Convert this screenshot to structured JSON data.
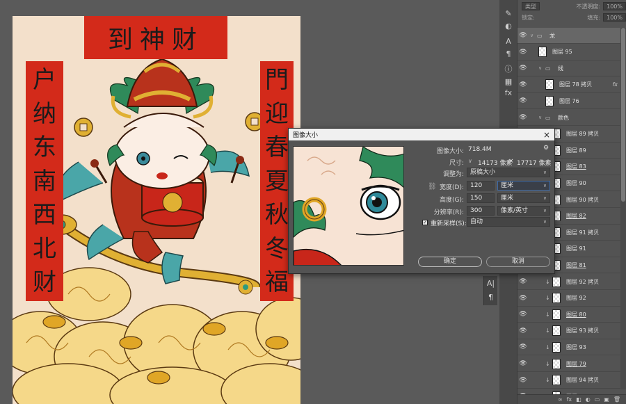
{
  "canvas": {
    "title_banner": "到神财",
    "left_banner": [
      "户",
      "纳",
      "东",
      "南",
      "西",
      "北",
      "财"
    ],
    "right_banner": [
      "門",
      "迎",
      "春",
      "夏",
      "秋",
      "冬",
      "福"
    ]
  },
  "dialog": {
    "title": "图像大小",
    "close_icon": "×",
    "image_size_label": "图像大小:",
    "image_size_value": "718.4M",
    "gear_icon": "⚙",
    "dimensions_label": "尺寸:",
    "dimensions_w": "14173 像素",
    "dimensions_x": "×",
    "dimensions_h": "17717 像素",
    "fit_to_label": "调整为:",
    "fit_to_value": "原稿大小",
    "width_label": "宽度(D):",
    "width_value": "120",
    "width_unit": "厘米",
    "height_label": "高度(G):",
    "height_value": "150",
    "height_unit": "厘米",
    "resolution_label": "分辨率(R):",
    "resolution_value": "300",
    "resolution_unit": "像素/英寸",
    "resample_label": "重新采样(S):",
    "resample_value": "自动",
    "resample_checked": "✓",
    "ok_label": "确定",
    "cancel_label": "取消"
  },
  "tool_strip": [
    "A|",
    "¶"
  ],
  "panel": {
    "top_row1": [
      "类型",
      "不透明度:",
      "100%"
    ],
    "top_row2": [
      "锁定:",
      "填充:",
      "100%"
    ],
    "layers": [
      {
        "name": "龙",
        "type": "folder",
        "selected": true
      },
      {
        "name": "图层 95",
        "type": "layer"
      },
      {
        "name": "线",
        "type": "folder"
      },
      {
        "name": "图层 78 拷贝",
        "type": "layer",
        "fx": "fx"
      },
      {
        "name": "图层 76",
        "type": "layer"
      },
      {
        "name": "颜色",
        "type": "folder"
      },
      {
        "name": "图层 89 拷贝",
        "type": "layer"
      },
      {
        "name": "图层 89",
        "type": "layer"
      },
      {
        "name": "图层 83",
        "type": "layer",
        "underline": true
      },
      {
        "name": "图层 90",
        "type": "layer"
      },
      {
        "name": "图层 90 拷贝",
        "type": "layer"
      },
      {
        "name": "图层 82",
        "type": "layer",
        "underline": true
      },
      {
        "name": "图层 91 拷贝",
        "type": "layer"
      },
      {
        "name": "图层 91",
        "type": "layer"
      },
      {
        "name": "图层 81",
        "type": "layer",
        "underline": true
      },
      {
        "name": "图层 92 拷贝",
        "type": "layer"
      },
      {
        "name": "图层 92",
        "type": "layer"
      },
      {
        "name": "图层 80",
        "type": "layer",
        "underline": true
      },
      {
        "name": "图层 93 拷贝",
        "type": "layer"
      },
      {
        "name": "图层 93",
        "type": "layer"
      },
      {
        "name": "图层 79",
        "type": "layer",
        "underline": true
      },
      {
        "name": "图层 94 拷贝",
        "type": "layer"
      },
      {
        "name": "图层 94",
        "type": "layer"
      }
    ],
    "footer_icons": [
      "∞",
      "fx",
      "◧",
      "◐",
      "▭",
      "▣",
      "🗑"
    ]
  },
  "colors": {
    "banner_red": "#d32a1a",
    "canvas_bg": "#f3e0cb",
    "ui_bg": "#5a5a5a",
    "panel_bg": "#535353"
  }
}
